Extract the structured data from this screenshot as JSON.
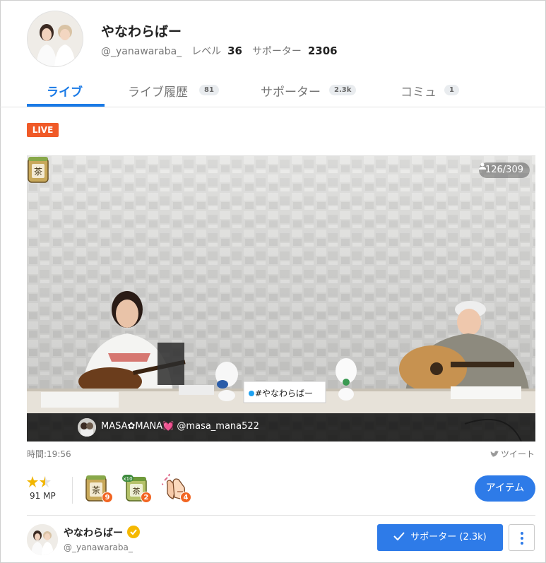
{
  "profile": {
    "name": "やなわらばー",
    "handle": "@_yanawaraba_",
    "level_label": "レベル",
    "level": "36",
    "supporters_label": "サポーター",
    "supporters": "2306"
  },
  "tabs": [
    {
      "label": "ライブ",
      "badge": "",
      "active": true
    },
    {
      "label": "ライブ履歴",
      "badge": "81",
      "active": false
    },
    {
      "label": "サポーター",
      "badge": "2.3k",
      "active": false
    },
    {
      "label": "コミュ",
      "badge": "1",
      "active": false
    }
  ],
  "live": {
    "badge": "LIVE",
    "viewers": "126/309",
    "caption": "MASA✿MANA💓 @masa_mana522",
    "table_sign": "#やなわらばー",
    "time": "時間:19:56",
    "tweet": "ツイート"
  },
  "stats": {
    "rating": 1.5,
    "mp": "91 MP"
  },
  "gifts": [
    {
      "icon": "tea-cup-icon",
      "count": "9"
    },
    {
      "icon": "tea-cup-x10-icon",
      "count": "2",
      "multiplier": "x10"
    },
    {
      "icon": "clap-hands-icon",
      "count": "4"
    }
  ],
  "item_button": "アイテム",
  "footer": {
    "name": "やなわらばー",
    "handle": "@_yanawaraba_",
    "support_button": "サポーター (2.3k)"
  },
  "colors": {
    "accent": "#1a7ae6",
    "button": "#2e7be8",
    "live": "#f05a28",
    "count_badge": "#f26522",
    "verified": "#f5b800"
  }
}
